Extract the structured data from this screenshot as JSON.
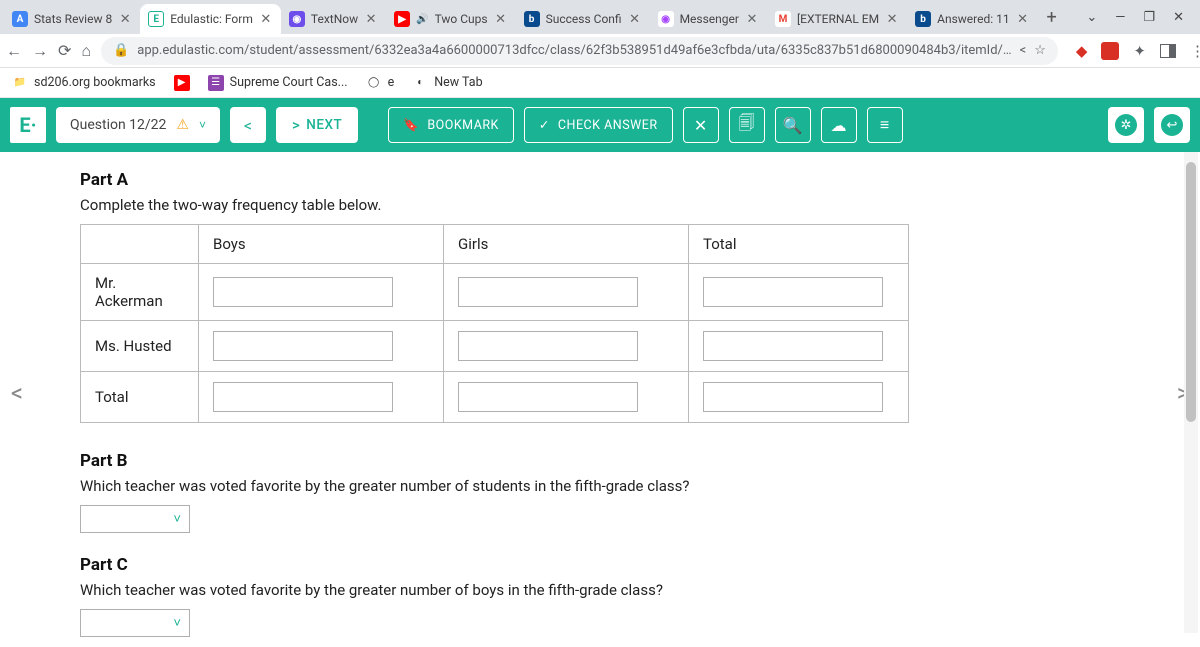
{
  "browser": {
    "tabs": [
      {
        "favicon_bg": "#4285f4",
        "favicon_txt": "A",
        "title": "Stats Review 8",
        "close": true
      },
      {
        "favicon_bg": "#ffffff",
        "favicon_txt": "E",
        "favicon_color": "#1ab394",
        "favicon_border": "1px solid #1ab394",
        "title": "Edulastic: Form",
        "active": true,
        "close": true
      },
      {
        "favicon_bg": "#6e4eea",
        "favicon_txt": "◉",
        "title": "TextNow",
        "close": true
      },
      {
        "favicon_bg": "#ff0000",
        "favicon_txt": "▶",
        "title": "Two Cups",
        "close": true,
        "audio": true
      },
      {
        "favicon_bg": "#0a4b8e",
        "favicon_txt": "b",
        "title": "Success Confi",
        "close": true
      },
      {
        "favicon_bg": "#ffffff",
        "favicon_txt": "◉",
        "favicon_color": "#a845ff",
        "title": "Messenger",
        "close": true
      },
      {
        "favicon_bg": "#ffffff",
        "favicon_txt": "M",
        "favicon_color": "#ea4335",
        "title": "[EXTERNAL EM",
        "close": true
      },
      {
        "favicon_bg": "#0a4b8e",
        "favicon_txt": "b",
        "title": "Answered: 11",
        "close": true
      }
    ],
    "url": "app.edulastic.com/student/assessment/6332ea3a4a6600000713dfcc/class/62f3b538951d49af6e3cfbda/uta/6335c837b51d6800090484b3/itemId/…",
    "bookmarks": [
      {
        "icon": "📁",
        "icon_bg": "",
        "label": "sd206.org bookmarks"
      },
      {
        "icon": "▶",
        "icon_bg": "#ff0000",
        "label": ""
      },
      {
        "icon": "☰",
        "icon_bg": "#8e44ad",
        "label": "Supreme Court Cas..."
      },
      {
        "icon": "◯",
        "icon_bg": "",
        "label": "e"
      },
      {
        "icon": "◐",
        "icon_bg": "",
        "label": "New Tab"
      }
    ]
  },
  "edulastic": {
    "logo": "E·",
    "question_counter": "Question 12/22",
    "next_label": "NEXT",
    "bookmark_label": "BOOKMARK",
    "check_label": "CHECK ANSWER"
  },
  "content": {
    "partA": {
      "header": "Part A",
      "instruction": "Complete the two-way frequency table below.",
      "cols": [
        "",
        "Boys",
        "Girls",
        "Total"
      ],
      "rows": [
        "Mr. Ackerman",
        "Ms. Husted",
        "Total"
      ]
    },
    "partB": {
      "header": "Part B",
      "instruction": "Which teacher was voted favorite by the greater number of students in the fifth-grade class?"
    },
    "partC": {
      "header": "Part C",
      "instruction": "Which teacher was voted favorite by the greater number of boys in the fifth-grade class?"
    }
  }
}
